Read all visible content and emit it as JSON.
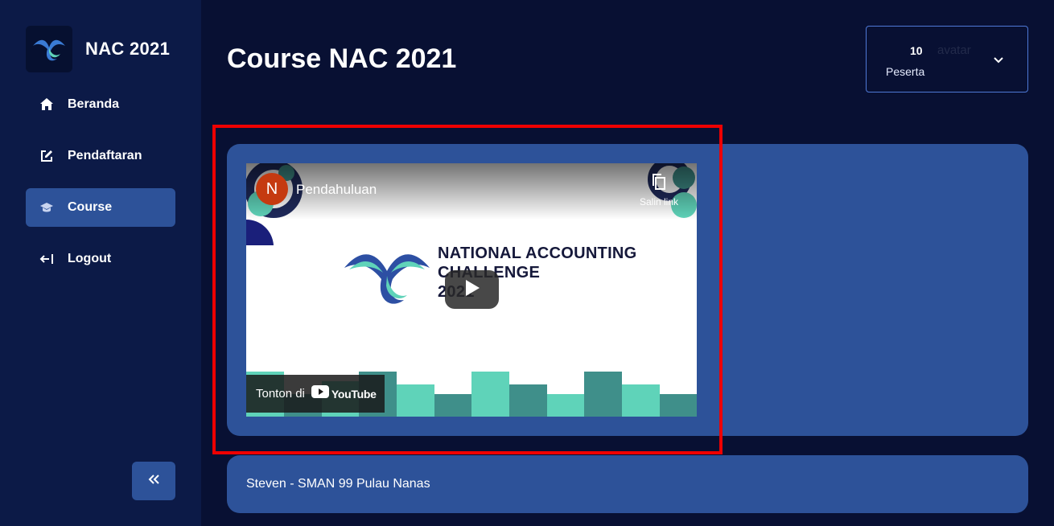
{
  "brand": {
    "name": "NAC 2021"
  },
  "sidebar": {
    "items": [
      {
        "label": "Beranda",
        "icon": "home-icon"
      },
      {
        "label": "Pendaftaran",
        "icon": "edit-icon"
      },
      {
        "label": "Course",
        "icon": "graduation-cap-icon",
        "active": true
      },
      {
        "label": "Logout",
        "icon": "logout-icon"
      }
    ],
    "collapse_icon": "double-chevron-left-icon"
  },
  "header": {
    "title": "Course NAC 2021",
    "user": {
      "count": "10",
      "avatar_alt": "avatar",
      "role": "Peserta"
    }
  },
  "video": {
    "channel_initial": "N",
    "title": "Pendahuluan",
    "copy_link_label": "Salin link",
    "overlay_text": [
      "NATIONAL ACCOUNTING",
      "CHALLENGE",
      "2021"
    ],
    "watch_on_label": "Tonton di",
    "youtube_label": "YouTube"
  },
  "info": {
    "text": "Steven - SMAN 99 Pulau Nanas"
  },
  "colors": {
    "background": "#081033",
    "sidebar": "#0c1a47",
    "card": "#2d5299",
    "highlight": "#ee0000",
    "teal": "#5fd3b9"
  }
}
